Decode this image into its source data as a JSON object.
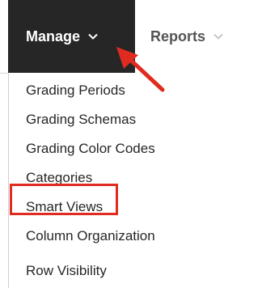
{
  "nav": {
    "manage_label": "Manage",
    "reports_label": "Reports"
  },
  "menu": {
    "items": [
      {
        "label": "Grading Periods"
      },
      {
        "label": "Grading Schemas"
      },
      {
        "label": "Grading Color Codes"
      },
      {
        "label": "Categories"
      },
      {
        "label": "Smart Views"
      },
      {
        "label": "Column Organization"
      },
      {
        "label": "Row Visibility"
      }
    ]
  },
  "annotations": {
    "arrow_color": "#e02b20",
    "highlight_color": "#e02b20"
  },
  "icons": {
    "manage_dropdown": "chevron-down-icon",
    "reports_dropdown": "chevron-down-icon"
  }
}
